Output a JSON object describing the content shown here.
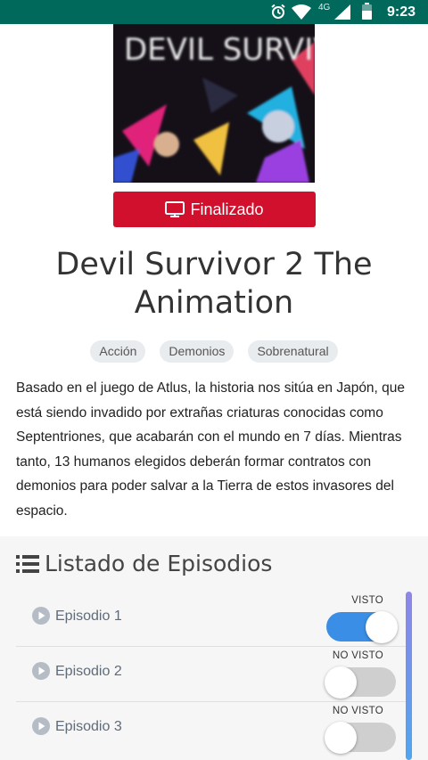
{
  "status_bar": {
    "time": "9:23",
    "network": "4G",
    "icons": [
      "alarm-icon",
      "wifi-icon",
      "signal-icon",
      "battery-icon"
    ],
    "bg_color": "#00695c"
  },
  "anime": {
    "poster_text": "DEVIL SURVIVOR",
    "status_label": "Finalizado",
    "status_color": "#d0102c",
    "title": "Devil Survivor 2 The Animation",
    "genres": [
      "Acción",
      "Demonios",
      "Sobrenatural"
    ],
    "synopsis": "Basado en el juego de Atlus, la historia nos sitúa en Japón, que está siendo invadido por extrañas criaturas conocidas como Septentriones, que acabarán con el mundo en 7 días. Mientras tanto, 13 humanos elegidos deberán formar contratos con demonios para poder salvar a la Tierra de estos invasores del espacio."
  },
  "episodes": {
    "header": "Listado de Episodios",
    "items": [
      {
        "name": "Episodio 1",
        "seen_label": "VISTO",
        "seen": true
      },
      {
        "name": "Episodio 2",
        "seen_label": "NO VISTO",
        "seen": false
      },
      {
        "name": "Episodio 3",
        "seen_label": "NO VISTO",
        "seen": false
      }
    ],
    "toggle_on_color": "#3a8ee6"
  }
}
